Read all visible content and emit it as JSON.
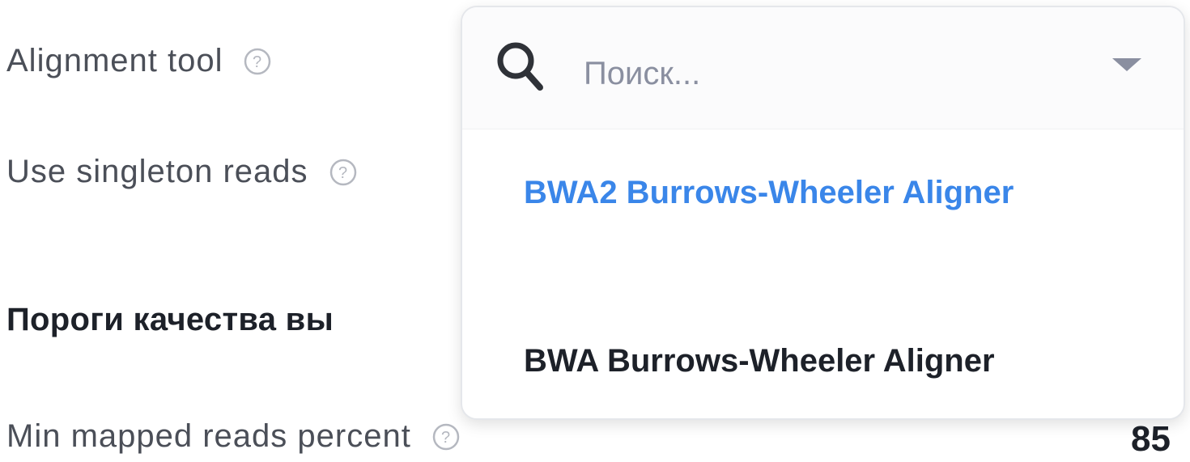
{
  "settings": {
    "alignment_tool": {
      "label": "Alignment tool"
    },
    "singleton_reads": {
      "label": "Use singleton reads"
    },
    "section_title": "Пороги качества вы",
    "min_mapped": {
      "label": "Min mapped reads percent",
      "value": "85"
    }
  },
  "dropdown": {
    "search_placeholder": "Поиск...",
    "search_value": "",
    "options": [
      {
        "label": "BWA2 Burrows-Wheeler Aligner",
        "selected": true
      },
      {
        "label": "BWA Burrows-Wheeler Aligner",
        "selected": false
      }
    ]
  },
  "icons": {
    "help": "question-circle-icon",
    "search": "magnifier-icon",
    "chevron": "triangle-down-icon"
  },
  "colors": {
    "accent": "#3a86e9",
    "text_primary": "#1d2129",
    "text_secondary": "#4b4f58",
    "placeholder": "#8a8fa0"
  }
}
